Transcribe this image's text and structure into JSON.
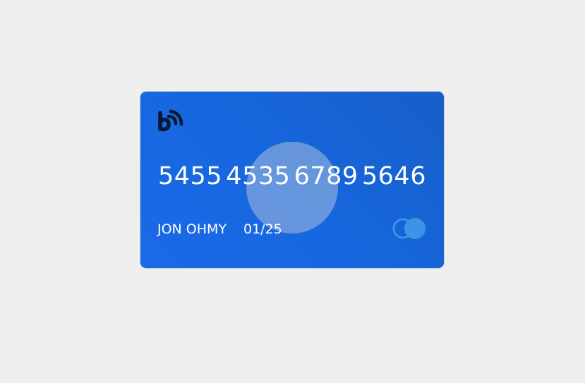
{
  "card": {
    "number_groups": [
      "5455",
      "4535",
      "6789",
      "5646"
    ],
    "holder_name": "JON OHMY",
    "expiry": "01/25",
    "brand_logo_icon": "contactless-b-logo-icon",
    "network_icon": "card-network-circles-icon"
  },
  "colors": {
    "background": "#efefef",
    "card_gradient_start": "#1c69e8",
    "card_gradient_end": "#175fc8",
    "text": "#ffffff",
    "overlay_circle": "#aabedc",
    "network_circle": "#3b95e4"
  }
}
